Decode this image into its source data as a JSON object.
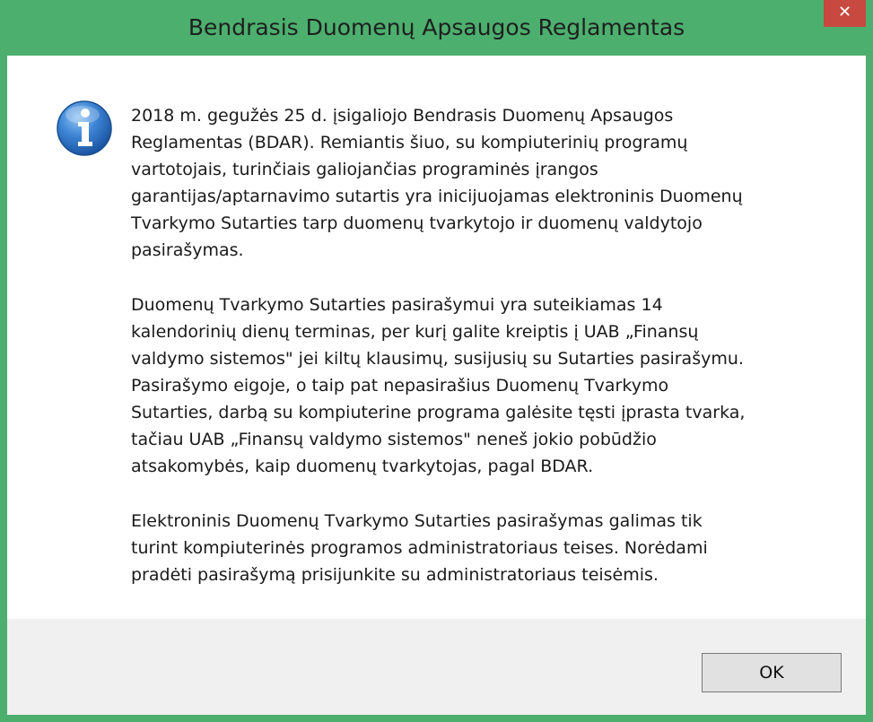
{
  "window": {
    "title": "Bendrasis Duomenų Apsaugos Reglamentas",
    "close_label": "✕"
  },
  "icon": "info-icon",
  "message": {
    "paragraphs": [
      "2018 m. gegužės 25 d. įsigaliojo Bendrasis Duomenų Apsaugos\nReglamentas (BDAR). Remiantis šiuo, su kompiuterinių programų\nvartotojais, turinčiais galiojančias programinės įrangos\ngarantijas/aptarnavimo sutartis yra inicijuojamas elektroninis Duomenų\nTvarkymo Sutarties tarp duomenų tvarkytojo ir duomenų valdytojo\npasirašymas.",
      "Duomenų Tvarkymo Sutarties pasirašymui yra suteikiamas  14\nkalendorinių dienų terminas, per kurį galite kreiptis į UAB „Finansų\nvaldymo sistemos\" jei kiltų klausimų, susijusių su Sutarties pasirašymu.\nPasirašymo eigoje, o taip pat nepasirašius Duomenų Tvarkymo\nSutarties, darbą su kompiuterine programa galėsite tęsti įprasta tvarka,\ntačiau UAB „Finansų valdymo sistemos\" neneš jokio pobūdžio\natsakomybės, kaip duomenų tvarkytojas, pagal BDAR.",
      "Elektroninis Duomenų Tvarkymo Sutarties pasirašymas galimas tik\nturint kompiuterinės programos administratoriaus teises. Norėdami\npradėti pasirašymą prisijunkite su administratoriaus teisėmis."
    ]
  },
  "buttons": {
    "ok_label": "OK"
  },
  "colors": {
    "frame": "#4caf6e",
    "close": "#c7493f",
    "footer": "#f0f0f0"
  }
}
